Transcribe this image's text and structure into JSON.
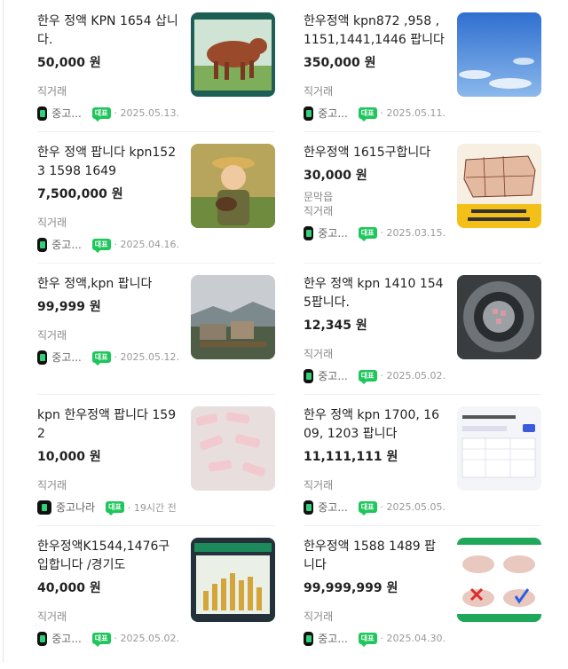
{
  "listings": [
    {
      "title": "한우 정액 KPN 1654 삽니다.",
      "price": "50,000 원",
      "extra": "",
      "deal": "직거래",
      "source": "중고...",
      "badge": "대표",
      "date": "2025.05.13.",
      "thumb": "cow-icon"
    },
    {
      "title": "한우정액 kpn872 ,958 ,1151,1441,1446 팝니다",
      "price": "350,000 원",
      "extra": "",
      "deal": "직거래",
      "source": "중고...",
      "badge": "대표",
      "date": "2025.05.11.",
      "thumb": "sky-icon"
    },
    {
      "title": "한우 정액 팝니다 kpn1523 1598 1649",
      "price": "7,500,000 원",
      "extra": "",
      "deal": "직거래",
      "source": "중고...",
      "badge": "대표",
      "date": "2025.04.16.",
      "thumb": "farmer-icon"
    },
    {
      "title": "한우정액 1615구합니다",
      "price": "30,000 원",
      "extra": "문막읍",
      "deal": "직거래",
      "source": "중고...",
      "badge": "대표",
      "date": "2025.03.15.",
      "thumb": "beef-chart-icon"
    },
    {
      "title": "한우 정액,kpn 팝니다",
      "price": "99,999 원",
      "extra": "",
      "deal": "직거래",
      "source": "중고...",
      "badge": "대표",
      "date": "2025.05.12.",
      "thumb": "town-icon"
    },
    {
      "title": "한우 정액 kpn 1410 1545팝니다.",
      "price": "12,345 원",
      "extra": "",
      "deal": "직거래",
      "source": "중고...",
      "badge": "대표",
      "date": "2025.05.02.",
      "thumb": "tank-icon"
    },
    {
      "title": "kpn 한우정액 팝니다 1592",
      "price": "10,000 원",
      "extra": "",
      "deal": "직거래",
      "source": "중고나라",
      "badge": "대표",
      "date": "19시간 전",
      "thumb": "straws-icon"
    },
    {
      "title": "한우 정액 kpn 1700, 1609, 1203 팝니다",
      "price": "11,111,111 원",
      "extra": "",
      "deal": "직거래",
      "source": "중고...",
      "badge": "대표",
      "date": "2025.05.05.",
      "thumb": "table-screenshot-icon"
    },
    {
      "title": "한우정액K1544,1476구입합니다 /경기도",
      "price": "40,000 원",
      "extra": "",
      "deal": "직거래",
      "source": "중고...",
      "badge": "대표",
      "date": "2025.05.02.",
      "thumb": "price-chart-icon"
    },
    {
      "title": "한우정액 1588 1489 팝니다",
      "price": "99,999,999 원",
      "extra": "",
      "deal": "직거래",
      "source": "중고...",
      "badge": "대표",
      "date": "2025.04.30.",
      "thumb": "diagram-icon"
    }
  ]
}
